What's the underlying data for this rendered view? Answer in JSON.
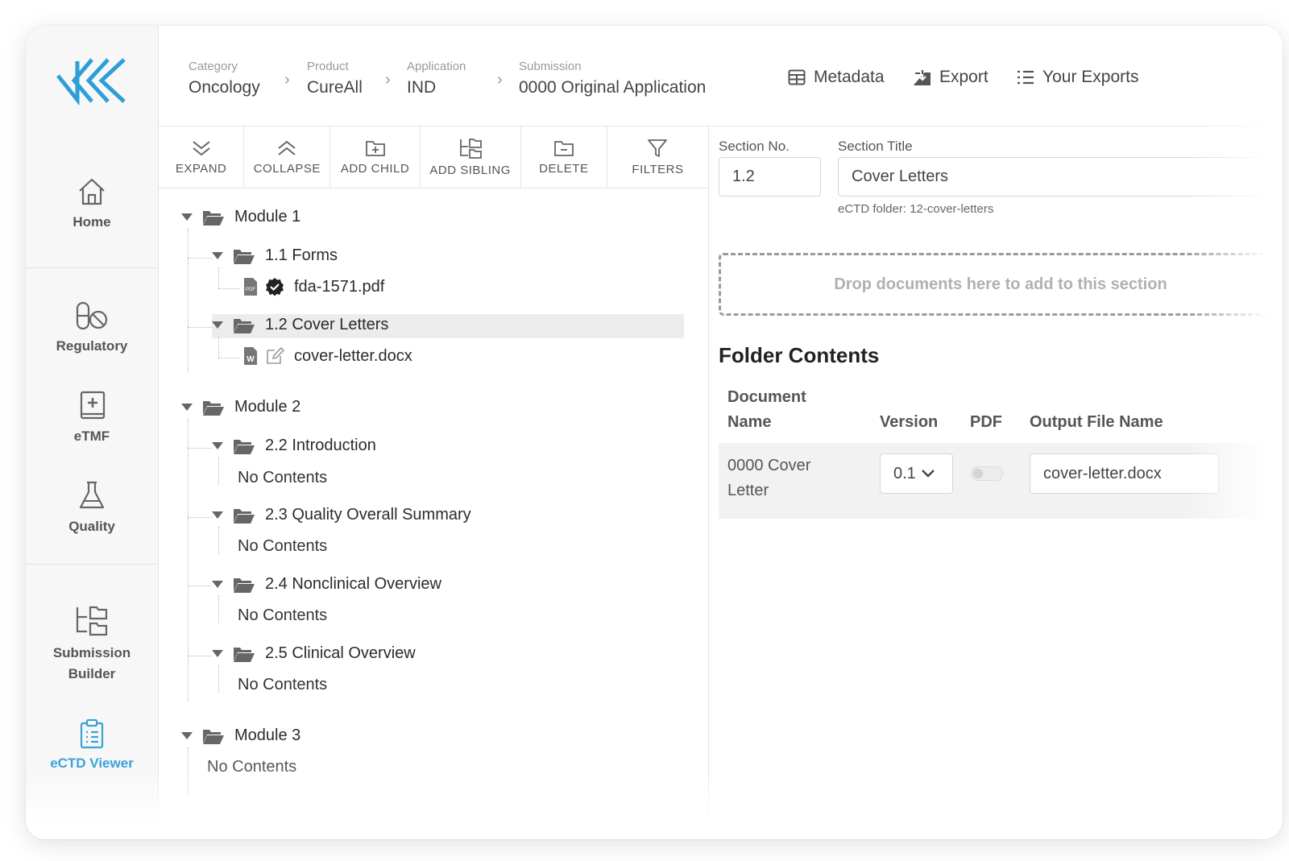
{
  "sidebar": {
    "logo_icon": "kk-logo-icon",
    "items": [
      {
        "label": "Home",
        "icon": "home-icon"
      },
      {
        "label": "Regulatory",
        "icon": "pills-icon"
      },
      {
        "label": "eTMF",
        "icon": "medical-book-icon"
      },
      {
        "label": "Quality",
        "icon": "flask-icon"
      },
      {
        "label": "Submission\nBuilder",
        "label_line1": "Submission",
        "label_line2": "Builder",
        "icon": "submission-builder-icon"
      },
      {
        "label": "eCTD Viewer",
        "icon": "clipboard-list-icon",
        "active": true
      }
    ],
    "active_color": "#3aa3d6"
  },
  "header": {
    "breadcrumb": [
      {
        "label": "Category",
        "value": "Oncology"
      },
      {
        "label": "Product",
        "value": "CureAll"
      },
      {
        "label": "Application",
        "value": "IND"
      },
      {
        "label": "Submission",
        "value": "0000 Original Application"
      }
    ],
    "actions": [
      {
        "label": "Metadata",
        "icon": "table-icon"
      },
      {
        "label": "Export",
        "icon": "download-box-icon"
      },
      {
        "label": "Your Exports",
        "icon": "list-icon"
      }
    ]
  },
  "toolbar": {
    "expand": "EXPAND",
    "collapse": "COLLAPSE",
    "add_child": "ADD CHILD",
    "add_sibling": "ADD SIBLING",
    "delete": "DELETE",
    "filters": "FILTERS"
  },
  "tree": {
    "module1": "Module 1",
    "forms": "1.1 Forms",
    "fda_file": "fda-1571.pdf",
    "cover_letters": "1.2 Cover Letters",
    "cover_file": "cover-letter.docx",
    "module2": "Module 2",
    "intro": "2.2 Introduction",
    "quality_summary": "2.3 Quality Overall Summary",
    "nonclinical": "2.4 Nonclinical Overview",
    "clinical": "2.5 Clinical Overview",
    "module3": "Module 3",
    "no_contents": "No Contents"
  },
  "detail": {
    "section_no_label": "Section No.",
    "section_no_value": "1.2",
    "section_title_label": "Section Title",
    "section_title_value": "Cover Letters",
    "ectd_folder": "eCTD folder: 12-cover-letters",
    "dropzone": "Drop documents here to add to this section",
    "folder_contents_title": "Folder Contents",
    "columns": {
      "doc_name_line1": "Document",
      "doc_name_line2": "Name",
      "version": "Version",
      "pdf": "PDF",
      "output": "Output File Name"
    },
    "rows": [
      {
        "doc_name_line1": "0000 Cover",
        "doc_name_line2": "Letter",
        "version": "0.1",
        "pdf_enabled": false,
        "output": "cover-letter.docx"
      }
    ]
  }
}
